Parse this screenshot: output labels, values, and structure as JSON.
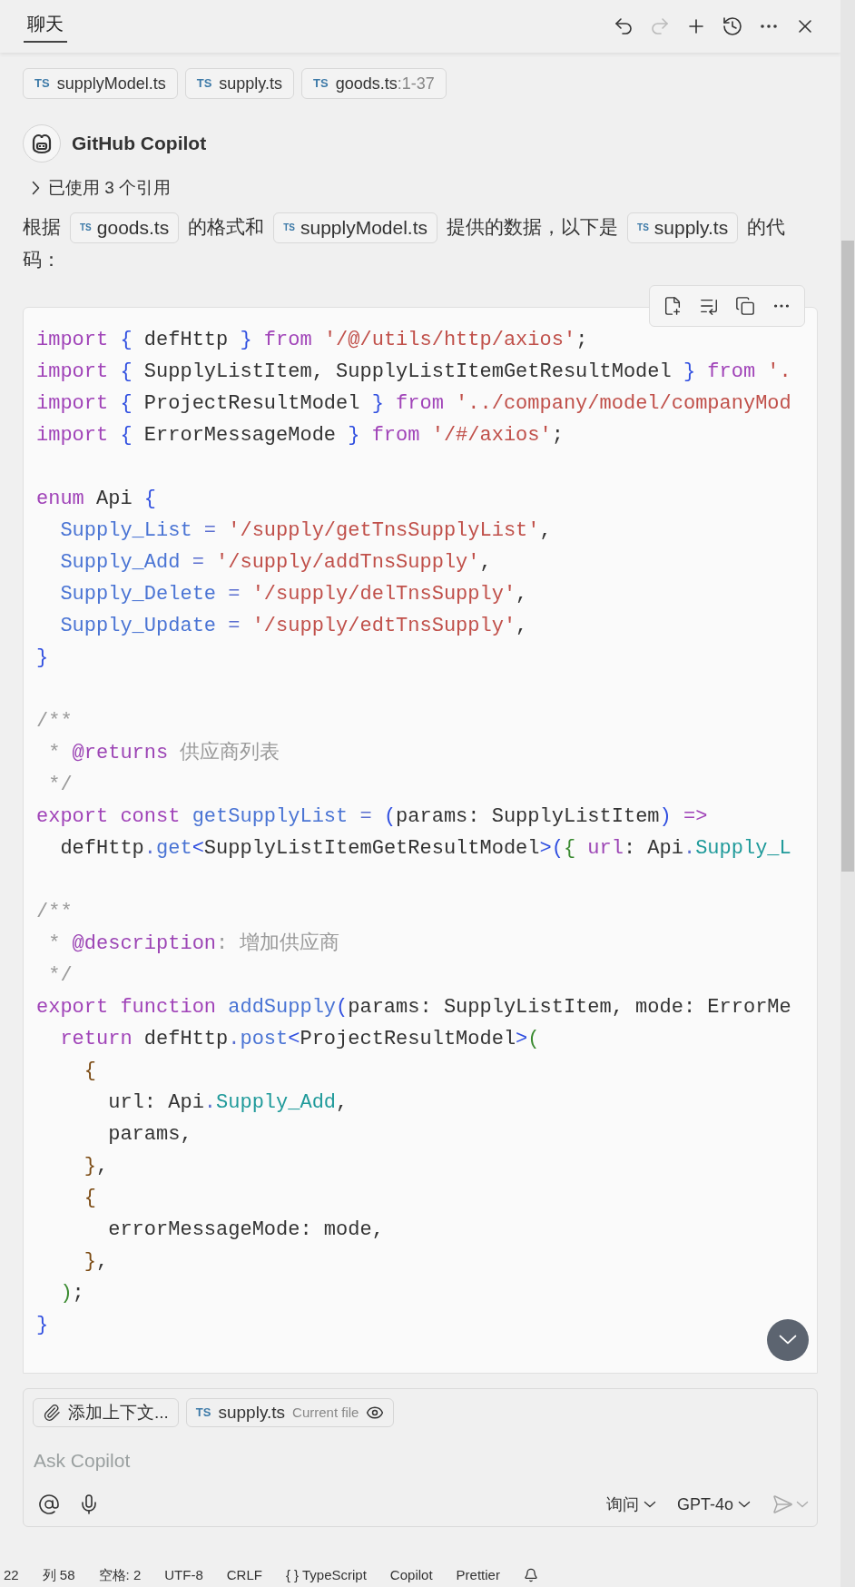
{
  "header": {
    "tab": {
      "label": "聊天",
      "selected": true
    },
    "actions": [
      {
        "kind": "undo",
        "disabled": false
      },
      {
        "kind": "redo",
        "disabled": true
      },
      {
        "kind": "new",
        "disabled": false
      },
      {
        "kind": "history",
        "disabled": false
      },
      {
        "kind": "more",
        "disabled": false
      },
      {
        "kind": "close",
        "disabled": false
      }
    ]
  },
  "context_chips": [
    {
      "icon_text": "TS",
      "name": "supplyModel.ts"
    },
    {
      "icon_text": "TS",
      "name": "supply.ts"
    },
    {
      "icon_text": "TS",
      "name": "goods.ts",
      "range": ":1-37"
    }
  ],
  "response": {
    "author": "GitHub Copilot",
    "references": {
      "label": "已使用 3 个引用",
      "expanded": false
    },
    "intro": [
      {
        "kind": "text",
        "text": "根据"
      },
      {
        "kind": "file",
        "icon_text": "TS",
        "name": "goods.ts"
      },
      {
        "kind": "text",
        "text": "的格式和"
      },
      {
        "kind": "file",
        "icon_text": "TS",
        "name": "supplyModel.ts"
      },
      {
        "kind": "text",
        "text": "提供的数据，以下是"
      },
      {
        "kind": "file",
        "icon_text": "TS",
        "name": "supply.ts"
      },
      {
        "kind": "text",
        "text": "的代码："
      }
    ],
    "code": [
      {
        "kind": "code",
        "tokens": [
          {
            "kind": "kw",
            "text": "import "
          },
          {
            "kind": "brace",
            "text": "{"
          },
          {
            "kind": "txt",
            "text": " defHttp "
          },
          {
            "kind": "brace",
            "text": "} "
          },
          {
            "kind": "kw",
            "text": "from "
          },
          {
            "kind": "str",
            "text": "'/@/utils/http/axios'"
          },
          {
            "kind": "txt",
            "text": ";"
          }
        ]
      },
      {
        "kind": "code",
        "tokens": [
          {
            "kind": "kw",
            "text": "import "
          },
          {
            "kind": "brace",
            "text": "{"
          },
          {
            "kind": "txt",
            "text": " SupplyListItem, SupplyListItemGetResultModel "
          },
          {
            "kind": "brace",
            "text": "} "
          },
          {
            "kind": "kw",
            "text": "from "
          },
          {
            "kind": "str",
            "text": "'."
          }
        ]
      },
      {
        "kind": "code",
        "tokens": [
          {
            "kind": "kw",
            "text": "import "
          },
          {
            "kind": "brace",
            "text": "{"
          },
          {
            "kind": "txt",
            "text": " ProjectResultModel "
          },
          {
            "kind": "brace",
            "text": "} "
          },
          {
            "kind": "kw",
            "text": "from "
          },
          {
            "kind": "str",
            "text": "'../company/model/companyMod"
          }
        ]
      },
      {
        "kind": "code",
        "tokens": [
          {
            "kind": "kw",
            "text": "import "
          },
          {
            "kind": "brace",
            "text": "{"
          },
          {
            "kind": "txt",
            "text": " ErrorMessageMode "
          },
          {
            "kind": "brace",
            "text": "} "
          },
          {
            "kind": "kw",
            "text": "from "
          },
          {
            "kind": "str",
            "text": "'/#/axios'"
          },
          {
            "kind": "txt",
            "text": ";"
          }
        ]
      },
      {
        "kind": "blank"
      },
      {
        "kind": "code",
        "tokens": [
          {
            "kind": "kw",
            "text": "enum"
          },
          {
            "kind": "txt",
            "text": " Api "
          },
          {
            "kind": "brace",
            "text": "{"
          }
        ]
      },
      {
        "kind": "code",
        "tokens": [
          {
            "kind": "member",
            "text": "  Supply_List"
          },
          {
            "kind": "op",
            "text": " = "
          },
          {
            "kind": "str",
            "text": "'/supply/getTnsSupplyList'"
          },
          {
            "kind": "txt",
            "text": ","
          }
        ]
      },
      {
        "kind": "code",
        "tokens": [
          {
            "kind": "member",
            "text": "  Supply_Add"
          },
          {
            "kind": "op",
            "text": " = "
          },
          {
            "kind": "str",
            "text": "'/supply/addTnsSupply'"
          },
          {
            "kind": "txt",
            "text": ","
          }
        ]
      },
      {
        "kind": "code",
        "tokens": [
          {
            "kind": "member",
            "text": "  Supply_Delete"
          },
          {
            "kind": "op",
            "text": " = "
          },
          {
            "kind": "str",
            "text": "'/supply/delTnsSupply'"
          },
          {
            "kind": "txt",
            "text": ","
          }
        ]
      },
      {
        "kind": "code",
        "tokens": [
          {
            "kind": "member",
            "text": "  Supply_Update"
          },
          {
            "kind": "op",
            "text": " = "
          },
          {
            "kind": "str",
            "text": "'/supply/edtTnsSupply'"
          },
          {
            "kind": "txt",
            "text": ","
          }
        ]
      },
      {
        "kind": "code",
        "tokens": [
          {
            "kind": "brace",
            "text": "}"
          }
        ]
      },
      {
        "kind": "blank"
      },
      {
        "kind": "code",
        "tokens": [
          {
            "kind": "cmt",
            "text": "/**"
          }
        ]
      },
      {
        "kind": "code",
        "tokens": [
          {
            "kind": "cmt",
            "text": " * "
          },
          {
            "kind": "tag",
            "text": "@returns"
          },
          {
            "kind": "cmt",
            "text": " 供应商列表"
          }
        ]
      },
      {
        "kind": "code",
        "tokens": [
          {
            "kind": "cmt",
            "text": " */"
          }
        ]
      },
      {
        "kind": "code",
        "tokens": [
          {
            "kind": "kw",
            "text": "export const "
          },
          {
            "kind": "member",
            "text": "getSupplyList"
          },
          {
            "kind": "op",
            "text": " = "
          },
          {
            "kind": "brace",
            "text": "("
          },
          {
            "kind": "txt",
            "text": "params: SupplyListItem"
          },
          {
            "kind": "brace",
            "text": ")"
          },
          {
            "kind": "kw",
            "text": " =>"
          }
        ]
      },
      {
        "kind": "code",
        "tokens": [
          {
            "kind": "txt",
            "text": "  defHttp"
          },
          {
            "kind": "op",
            "text": "."
          },
          {
            "kind": "member",
            "text": "get"
          },
          {
            "kind": "brace",
            "text": "<"
          },
          {
            "kind": "txt",
            "text": "SupplyListItemGetResultModel"
          },
          {
            "kind": "brace",
            "text": ">("
          },
          {
            "kind": "green",
            "text": "{ "
          },
          {
            "kind": "tag",
            "text": "url"
          },
          {
            "kind": "txt",
            "text": ": Api"
          },
          {
            "kind": "op",
            "text": "."
          },
          {
            "kind": "teal",
            "text": "Supply_L"
          }
        ]
      },
      {
        "kind": "blank"
      },
      {
        "kind": "code",
        "tokens": [
          {
            "kind": "cmt",
            "text": "/**"
          }
        ]
      },
      {
        "kind": "code",
        "tokens": [
          {
            "kind": "cmt",
            "text": " * "
          },
          {
            "kind": "tag",
            "text": "@description"
          },
          {
            "kind": "cmt",
            "text": ": 增加供应商"
          }
        ]
      },
      {
        "kind": "code",
        "tokens": [
          {
            "kind": "cmt",
            "text": " */"
          }
        ]
      },
      {
        "kind": "code",
        "tokens": [
          {
            "kind": "kw",
            "text": "export function "
          },
          {
            "kind": "member",
            "text": "addSupply"
          },
          {
            "kind": "brace",
            "text": "("
          },
          {
            "kind": "txt",
            "text": "params: SupplyListItem, mode: ErrorMe"
          }
        ]
      },
      {
        "kind": "code",
        "tokens": [
          {
            "kind": "kw",
            "text": "  return"
          },
          {
            "kind": "txt",
            "text": " defHttp"
          },
          {
            "kind": "op",
            "text": "."
          },
          {
            "kind": "member",
            "text": "post"
          },
          {
            "kind": "brace",
            "text": "<"
          },
          {
            "kind": "txt",
            "text": "ProjectResultModel"
          },
          {
            "kind": "brace",
            "text": ">"
          },
          {
            "kind": "green",
            "text": "("
          }
        ]
      },
      {
        "kind": "code",
        "tokens": [
          {
            "kind": "brown",
            "text": "    {"
          }
        ]
      },
      {
        "kind": "code",
        "tokens": [
          {
            "kind": "txt",
            "text": "      url: Api"
          },
          {
            "kind": "op",
            "text": "."
          },
          {
            "kind": "teal",
            "text": "Supply_Add"
          },
          {
            "kind": "txt",
            "text": ","
          }
        ]
      },
      {
        "kind": "code",
        "tokens": [
          {
            "kind": "txt",
            "text": "      params,"
          }
        ]
      },
      {
        "kind": "code",
        "tokens": [
          {
            "kind": "brown",
            "text": "    }"
          },
          {
            "kind": "txt",
            "text": ","
          }
        ]
      },
      {
        "kind": "code",
        "tokens": [
          {
            "kind": "brown",
            "text": "    {"
          }
        ]
      },
      {
        "kind": "code",
        "tokens": [
          {
            "kind": "txt",
            "text": "      errorMessageMode: mode,"
          }
        ]
      },
      {
        "kind": "code",
        "tokens": [
          {
            "kind": "brown",
            "text": "    }"
          },
          {
            "kind": "txt",
            "text": ","
          }
        ]
      },
      {
        "kind": "code",
        "tokens": [
          {
            "kind": "green",
            "text": "  )"
          },
          {
            "kind": "txt",
            "text": ";"
          }
        ]
      },
      {
        "kind": "code",
        "tokens": [
          {
            "kind": "brace",
            "text": "}"
          }
        ]
      }
    ]
  },
  "input": {
    "attach_label": "添加上下文...",
    "current_file": {
      "icon_text": "TS",
      "name": "supply.ts",
      "note": "Current file"
    },
    "placeholder": "Ask Copilot",
    "mode": "询问",
    "model": "GPT-4o"
  },
  "status_bar": [
    {
      "text": "22"
    },
    {
      "text": "列 58"
    },
    {
      "text": "空格: 2"
    },
    {
      "text": "UTF-8"
    },
    {
      "text": "CRLF"
    },
    {
      "text": "{ } TypeScript"
    },
    {
      "text": "Copilot"
    },
    {
      "text": "Prettier"
    }
  ]
}
